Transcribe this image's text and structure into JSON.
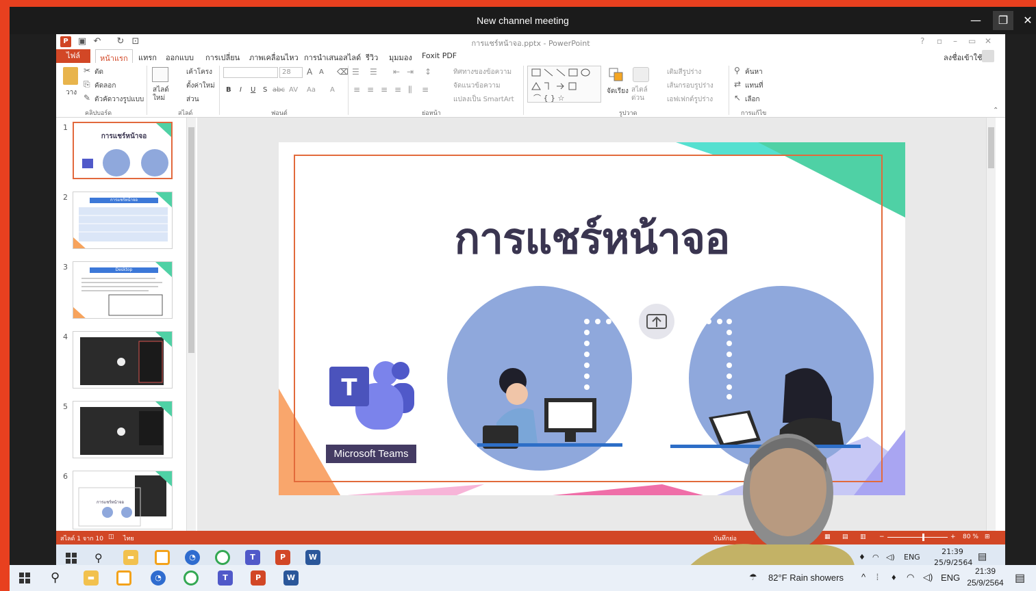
{
  "teams_window": {
    "title": "New channel meeting",
    "controls": {
      "minimize": "—",
      "restore": "❐",
      "close": "✕"
    }
  },
  "powerpoint": {
    "document_title": "การแชร์หน้าจอ.pptx - PowerPoint",
    "help": "?",
    "sign_in": "ลงชื่อเข้าใช้",
    "tabs": [
      {
        "label": "ไฟล์"
      },
      {
        "label": "หน้าแรก"
      },
      {
        "label": "แทรก"
      },
      {
        "label": "ออกแบบ"
      },
      {
        "label": "การเปลี่ยน"
      },
      {
        "label": "ภาพเคลื่อนไหว"
      },
      {
        "label": "การนำเสนอสไลด์"
      },
      {
        "label": "รีวิว"
      },
      {
        "label": "มุมมอง"
      },
      {
        "label": "Foxit PDF"
      }
    ],
    "ribbon": {
      "clipboard": {
        "paste": "วาง",
        "cut": "ตัด",
        "copy": "คัดลอก",
        "format_painter": "ตัวคัดวางรูปแบบ",
        "group": "คลิปบอร์ด"
      },
      "slides": {
        "new_slide": "สไลด์ใหม่",
        "layout": "เค้าโครง",
        "reset": "ตั้งค่าใหม่",
        "section": "ส่วน",
        "group": "สไลด์"
      },
      "font": {
        "font_size": "28",
        "bold": "B",
        "italic": "I",
        "underline": "U",
        "shadow": "S",
        "strike": "abc",
        "spacing": "AV",
        "case": "Aa",
        "color": "A",
        "group": "ฟอนต์"
      },
      "paragraph": {
        "text_direction": "ทิศทางของข้อความ",
        "align_text": "จัดแนวข้อความ",
        "smartart": "แปลงเป็น SmartArt",
        "group": "ย่อหน้า"
      },
      "drawing": {
        "arrange": "จัดเรียง",
        "quick_styles": "สไตล์ด่วน",
        "shape_fill": "เติมสีรูปร่าง",
        "shape_outline": "เส้นกรอบรูปร่าง",
        "shape_effects": "เอฟเฟกต์รูปร่าง",
        "group": "รูปวาด"
      },
      "editing": {
        "find": "ค้นหา",
        "replace": "แทนที่",
        "select": "เลือก",
        "group": "การแก้ไข"
      }
    },
    "thumbnails": [
      {
        "num": "1",
        "title": "การแชร์หน้าจอ"
      },
      {
        "num": "2",
        "title": "การแชร์หน้าจอ"
      },
      {
        "num": "3",
        "title": "Desktop"
      },
      {
        "num": "4",
        "title": ""
      },
      {
        "num": "5",
        "title": ""
      },
      {
        "num": "6",
        "title": "การแชร์หน้าจอ"
      }
    ],
    "slide": {
      "title": "การแชร์หน้าจอ",
      "teams_label": "Microsoft Teams",
      "teams_letter": "T"
    },
    "statusbar": {
      "slide_count": "สไลด์ 1 จาก 10",
      "language": "ไทย",
      "notes": "บันทึกย่อ",
      "zoom_minus": "−",
      "zoom_plus": "+",
      "zoom": "80 %",
      "zoom_fraction": 0.58
    }
  },
  "inner_taskbar": {
    "lang": "ENG",
    "time": "21:39",
    "date": "25/9/2564"
  },
  "outer_taskbar": {
    "weather": "82°F  Rain showers",
    "lang": "ENG",
    "time": "21:39",
    "date": "25/9/2564"
  },
  "colors": {
    "accent_orange": "#d24726",
    "frame_red": "#e8401f",
    "teams_purple": "#5059c9",
    "slide_circle": "#8fa8dc",
    "teams_label_bg": "#443b63"
  }
}
